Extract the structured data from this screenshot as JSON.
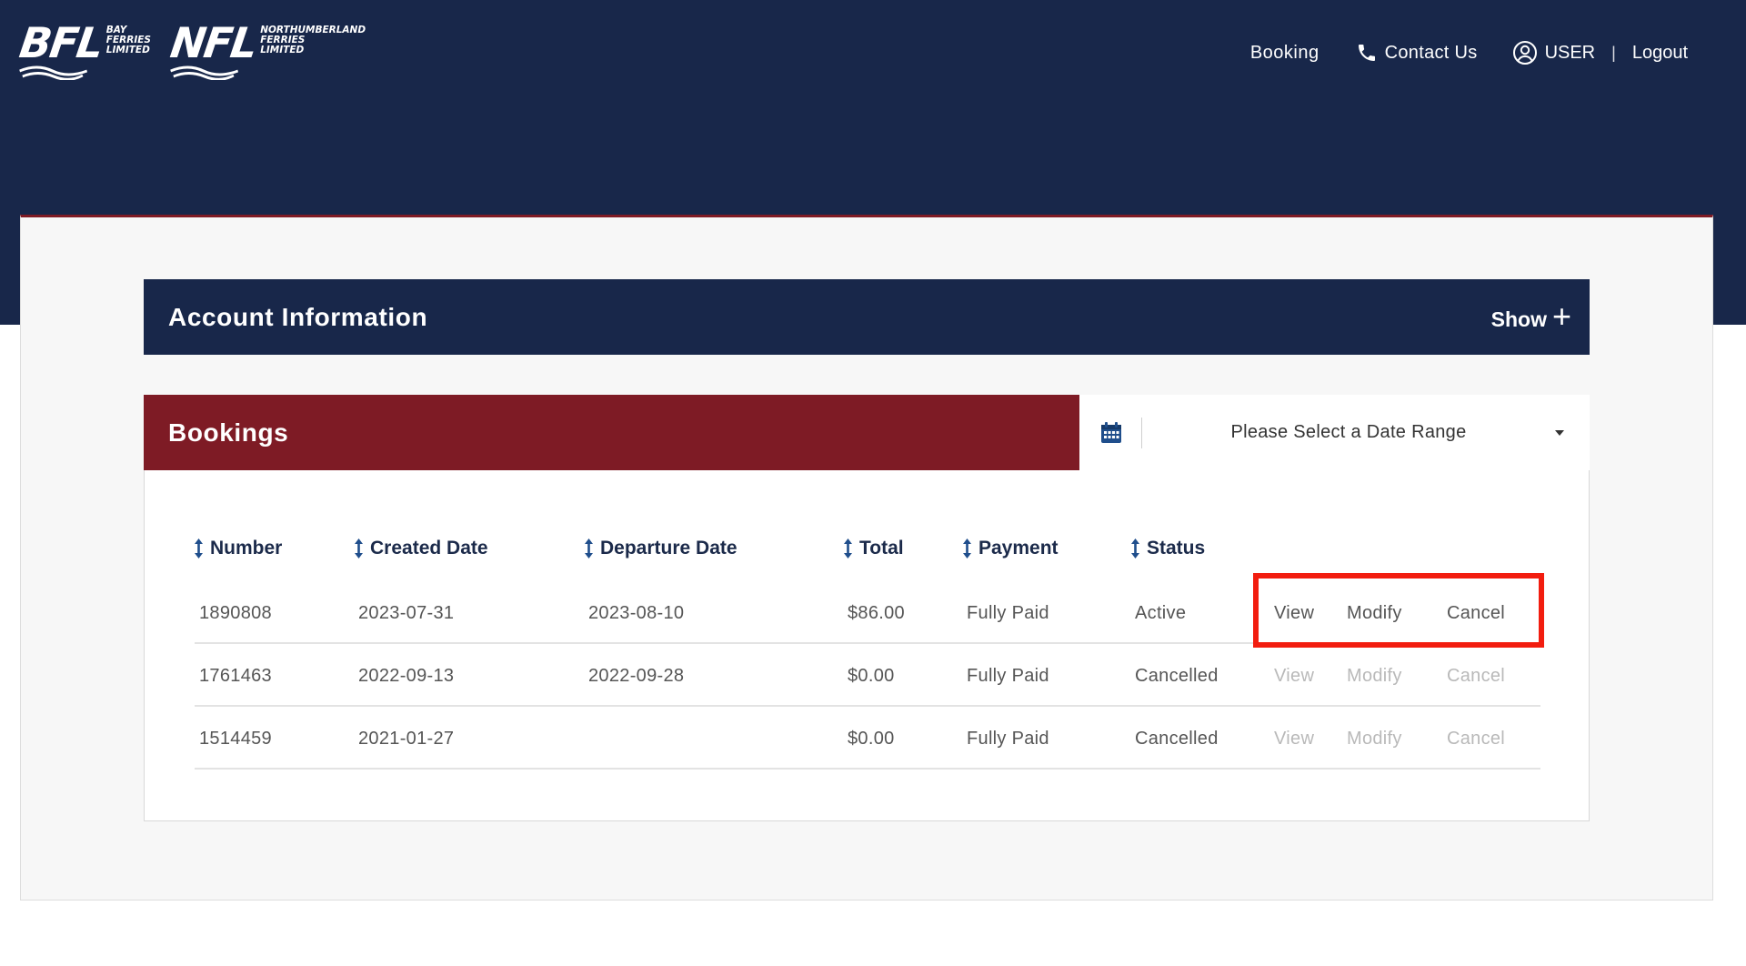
{
  "header": {
    "logos": [
      {
        "mark": "BFL",
        "sub": [
          "Bay",
          "Ferries",
          "Limited"
        ]
      },
      {
        "mark": "NFL",
        "sub": [
          "Northumberland",
          "Ferries",
          "Limited"
        ]
      }
    ],
    "nav": {
      "booking": "Booking",
      "contact": "Contact Us",
      "user": "USER",
      "separator": "|",
      "logout": "Logout"
    }
  },
  "account": {
    "title": "Account Information",
    "toggle": "Show",
    "toggle_icon": "+"
  },
  "bookings": {
    "title": "Bookings",
    "date_range_placeholder": "Please Select a Date Range",
    "columns": [
      "Number",
      "Created Date",
      "Departure Date",
      "Total",
      "Payment",
      "Status"
    ],
    "rows": [
      {
        "number": "1890808",
        "created": "2023-07-31",
        "departure": "2023-08-10",
        "total": "$86.00",
        "payment": "Fully Paid",
        "status": "Active",
        "actions": [
          "View",
          "Modify",
          "Cancel"
        ],
        "actions_enabled": true
      },
      {
        "number": "1761463",
        "created": "2022-09-13",
        "departure": "2022-09-28",
        "total": "$0.00",
        "payment": "Fully Paid",
        "status": "Cancelled",
        "actions": [
          "View",
          "Modify",
          "Cancel"
        ],
        "actions_enabled": false
      },
      {
        "number": "1514459",
        "created": "2021-01-27",
        "departure": "",
        "total": "$0.00",
        "payment": "Fully Paid",
        "status": "Cancelled",
        "actions": [
          "View",
          "Modify",
          "Cancel"
        ],
        "actions_enabled": false
      }
    ]
  },
  "colors": {
    "navy": "#18274a",
    "maroon": "#7e1b25",
    "highlight": "#f21d0f"
  },
  "icons": [
    "phone-icon",
    "user-circle-icon",
    "plus-icon",
    "calendar-icon",
    "caret-down-icon",
    "sort-icon"
  ]
}
